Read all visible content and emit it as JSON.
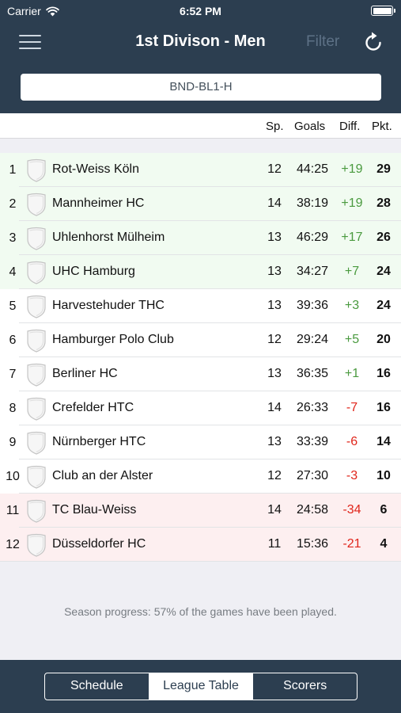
{
  "status_bar": {
    "carrier": "Carrier",
    "time": "6:52 PM"
  },
  "nav": {
    "title": "1st Divison - Men",
    "filter_label": "Filter",
    "menu_icon": "hamburger-menu-icon",
    "refresh_icon": "refresh-icon"
  },
  "league_selector": {
    "value": "BND-BL1-H"
  },
  "table": {
    "headers": {
      "sp": "Sp.",
      "goals": "Goals",
      "diff": "Diff.",
      "pkt": "Pkt."
    },
    "rows": [
      {
        "rank": "1",
        "team": "Rot-Weiss Köln",
        "sp": "12",
        "goals": "44:25",
        "diff": "+19",
        "pkt": "29",
        "zone": "green"
      },
      {
        "rank": "2",
        "team": "Mannheimer HC",
        "sp": "14",
        "goals": "38:19",
        "diff": "+19",
        "pkt": "28",
        "zone": "green"
      },
      {
        "rank": "3",
        "team": "Uhlenhorst Mülheim",
        "sp": "13",
        "goals": "46:29",
        "diff": "+17",
        "pkt": "26",
        "zone": "green"
      },
      {
        "rank": "4",
        "team": "UHC Hamburg",
        "sp": "13",
        "goals": "34:27",
        "diff": "+7",
        "pkt": "24",
        "zone": "green"
      },
      {
        "rank": "5",
        "team": "Harvestehuder THC",
        "sp": "13",
        "goals": "39:36",
        "diff": "+3",
        "pkt": "24",
        "zone": "white"
      },
      {
        "rank": "6",
        "team": "Hamburger Polo Club",
        "sp": "12",
        "goals": "29:24",
        "diff": "+5",
        "pkt": "20",
        "zone": "white"
      },
      {
        "rank": "7",
        "team": "Berliner HC",
        "sp": "13",
        "goals": "36:35",
        "diff": "+1",
        "pkt": "16",
        "zone": "white"
      },
      {
        "rank": "8",
        "team": "Crefelder HTC",
        "sp": "14",
        "goals": "26:33",
        "diff": "-7",
        "pkt": "16",
        "zone": "white"
      },
      {
        "rank": "9",
        "team": "Nürnberger HTC",
        "sp": "13",
        "goals": "33:39",
        "diff": "-6",
        "pkt": "14",
        "zone": "white"
      },
      {
        "rank": "10",
        "team": "Club an der Alster",
        "sp": "12",
        "goals": "27:30",
        "diff": "-3",
        "pkt": "10",
        "zone": "white"
      },
      {
        "rank": "11",
        "team": "TC Blau-Weiss",
        "sp": "14",
        "goals": "24:58",
        "diff": "-34",
        "pkt": "6",
        "zone": "red"
      },
      {
        "rank": "12",
        "team": "Düsseldorfer HC",
        "sp": "11",
        "goals": "15:36",
        "diff": "-21",
        "pkt": "4",
        "zone": "red"
      }
    ]
  },
  "season_progress": "Season progress: 57% of the games have been played.",
  "tabs": [
    {
      "label": "Schedule",
      "active": false
    },
    {
      "label": "League Table",
      "active": true
    },
    {
      "label": "Scorers",
      "active": false
    }
  ],
  "colors": {
    "nav_background": "#2c3e50",
    "positive_diff": "#4a9a3f",
    "negative_diff": "#e0251b",
    "promotion_row": "#f1fbf1",
    "relegation_row": "#fdeff0"
  }
}
